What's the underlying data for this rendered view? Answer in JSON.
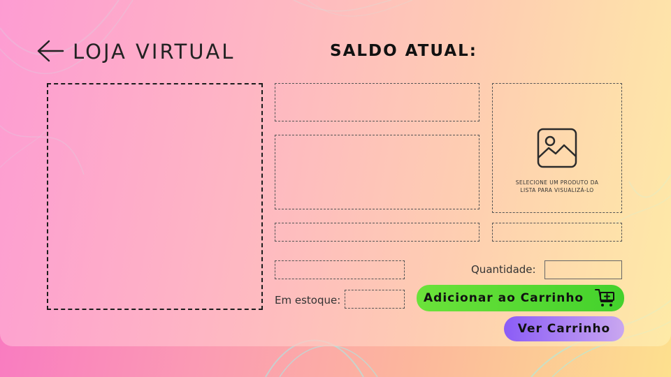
{
  "header": {
    "back_icon": "arrow-left-icon",
    "store_title": "LOJA VIRTUAL",
    "balance_label": "SALDO ATUAL:",
    "balance_value": ""
  },
  "product": {
    "list_values": [],
    "name_value": "",
    "description_value": "",
    "price_value": "",
    "category_value": "",
    "code_value": "",
    "preview_icon": "image-icon",
    "preview_placeholder_line1": "SELECIONE UM PRODUTO  DA",
    "preview_placeholder_line2": "LISTA PARA VISUALIZÁ-LO"
  },
  "purchase": {
    "quantity_label": "Quantidade:",
    "quantity_value": "",
    "stock_label": "Em estoque:",
    "stock_value": "",
    "add_to_cart_label": "Adicionar ao Carrinho",
    "add_to_cart_icon": "cart-plus-icon",
    "view_cart_label": "Ver Carrinho"
  },
  "colors": {
    "add_button": "#4cd430",
    "view_cart_button": "#8b5cf6",
    "background_pink": "#f873c4",
    "background_yellow": "#fde08e"
  }
}
